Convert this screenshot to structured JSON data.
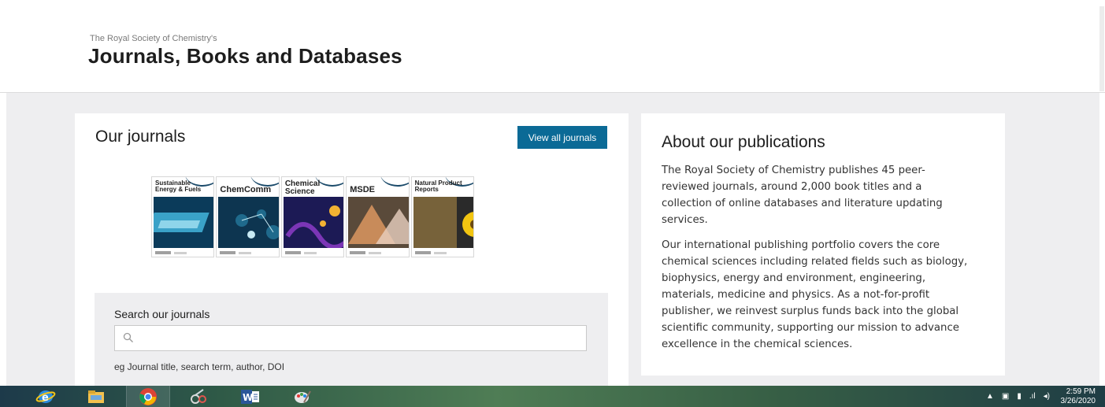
{
  "header": {
    "kicker": "The Royal Society of Chemistry's",
    "title": "Journals, Books and Databases"
  },
  "journals": {
    "heading": "Our journals",
    "view_all_label": "View all journals",
    "covers": [
      {
        "title": "Sustainable Energy & Fuels",
        "colors": [
          "#0b3b5a",
          "#3aa2c8",
          "#8fd5ea"
        ]
      },
      {
        "title": "ChemComm",
        "colors": [
          "#0d3550",
          "#1f6a8c",
          "#c7eaf3"
        ]
      },
      {
        "title": "Chemical Science",
        "colors": [
          "#1c1a55",
          "#7b36b6",
          "#f2b233"
        ]
      },
      {
        "title": "MSDE",
        "colors": [
          "#5a4a3a",
          "#c88b5a",
          "#e9d0c1"
        ]
      },
      {
        "title": "Natural Product Reports",
        "colors": [
          "#2a2a2a",
          "#77623a",
          "#f2c511"
        ]
      }
    ],
    "search": {
      "label": "Search our journals",
      "placeholder": "",
      "hint": "eg Journal title, search term, author, DOI"
    }
  },
  "about": {
    "heading": "About our publications",
    "p1": "The Royal Society of Chemistry publishes 45 peer-reviewed journals, around 2,000 book titles and a collection of online databases and literature updating services.",
    "p2": "Our international publishing portfolio covers the core chemical sciences including related fields such as biology, biophysics, energy and environment, engineering, materials, medicine and physics. As a not-for-profit publisher, we reinvest surplus funds back into the global scientific community, supporting our mission to advance excellence in the chemical sciences."
  },
  "taskbar": {
    "apps": [
      "internet-explorer-icon",
      "file-explorer-icon",
      "chrome-icon",
      "snipping-tool-icon",
      "word-icon",
      "paint-icon"
    ],
    "time": "2:59 PM",
    "date": "3/26/2020"
  },
  "colors": {
    "button": "#0b6a96",
    "page_bg": "#eeeef0"
  }
}
